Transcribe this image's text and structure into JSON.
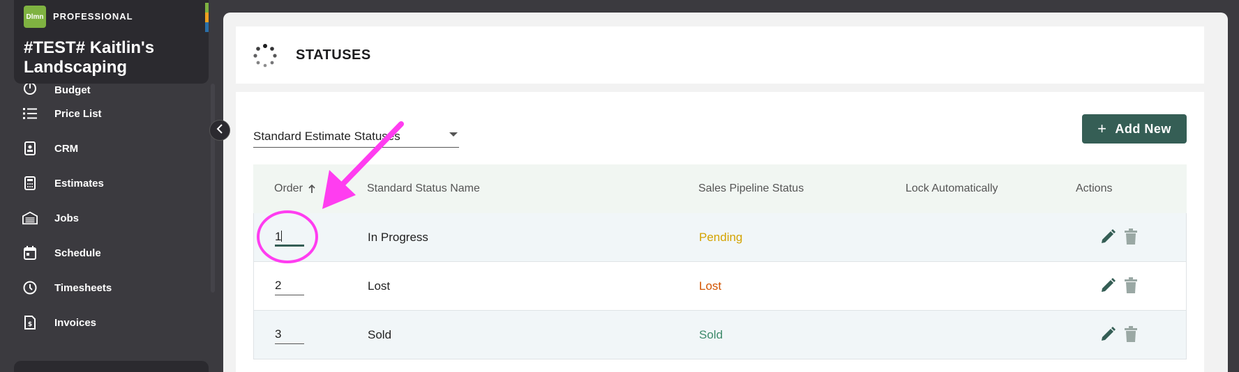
{
  "brand": {
    "logo_text": "Dlmn",
    "tier": "PROFESSIONAL",
    "company": "#TEST# Kaitlin's Landscaping",
    "stripe_colors": [
      "#7fb241",
      "#f0a020",
      "#2a6fa8"
    ]
  },
  "nav": {
    "items": [
      {
        "label": "Budget",
        "icon": "budget-icon"
      },
      {
        "label": "Price List",
        "icon": "list-icon"
      },
      {
        "label": "CRM",
        "icon": "contact-card-icon"
      },
      {
        "label": "Estimates",
        "icon": "calculator-icon"
      },
      {
        "label": "Jobs",
        "icon": "warehouse-icon"
      },
      {
        "label": "Schedule",
        "icon": "calendar-icon"
      },
      {
        "label": "Timesheets",
        "icon": "clock-icon"
      },
      {
        "label": "Invoices",
        "icon": "invoice-icon"
      }
    ]
  },
  "page": {
    "title": "STATUSES"
  },
  "filter": {
    "selected": "Standard Estimate Statuses"
  },
  "toolbar": {
    "add_label": "Add New",
    "add_icon": "plus-icon"
  },
  "table": {
    "headers": {
      "order": "Order",
      "name": "Standard Status Name",
      "pipeline": "Sales Pipeline Status",
      "lock": "Lock Automatically",
      "actions": "Actions"
    },
    "sort": {
      "column": "order",
      "direction": "ascending",
      "icon": "arrow-up-icon"
    },
    "rows": [
      {
        "order": "1",
        "name": "In Progress",
        "pipeline": "Pending",
        "pipeline_color": "#d4a300",
        "lock": ""
      },
      {
        "order": "2",
        "name": "Lost",
        "pipeline": "Lost",
        "pipeline_color": "#d35400",
        "lock": ""
      },
      {
        "order": "3",
        "name": "Sold",
        "pipeline": "Sold",
        "pipeline_color": "#3d8a6a",
        "lock": ""
      }
    ]
  },
  "colors": {
    "accent": "#355e55",
    "annotation": "#ff3df0",
    "sidebar_bg": "#3b3a3f"
  }
}
